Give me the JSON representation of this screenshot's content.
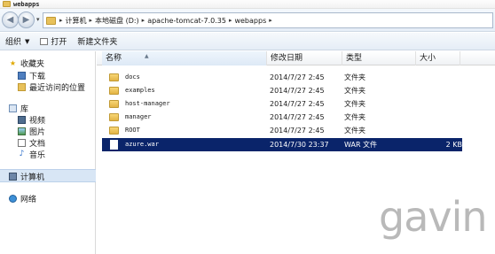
{
  "window": {
    "title": "webapps"
  },
  "address": {
    "crumbs": [
      "计算机",
      "本地磁盘 (D:)",
      "apache-tomcat-7.0.35",
      "webapps"
    ]
  },
  "toolbar": {
    "organize_label": "组织",
    "open_label": "打开",
    "new_folder_label": "新建文件夹"
  },
  "nav": {
    "favorites_label": "收藏夹",
    "favorites": [
      "下载",
      "最近访问的位置"
    ],
    "libraries_label": "库",
    "libraries": [
      "视频",
      "图片",
      "文档",
      "音乐"
    ],
    "computer_label": "计算机",
    "network_label": "网络"
  },
  "columns": {
    "name": "名称",
    "date": "修改日期",
    "type": "类型",
    "size": "大小"
  },
  "files": [
    {
      "name": "docs",
      "date": "2014/7/27 2:45",
      "type": "文件夹",
      "size": ""
    },
    {
      "name": "examples",
      "date": "2014/7/27 2:45",
      "type": "文件夹",
      "size": ""
    },
    {
      "name": "host-manager",
      "date": "2014/7/27 2:45",
      "type": "文件夹",
      "size": ""
    },
    {
      "name": "manager",
      "date": "2014/7/27 2:45",
      "type": "文件夹",
      "size": ""
    },
    {
      "name": "ROOT",
      "date": "2014/7/27 2:45",
      "type": "文件夹",
      "size": ""
    },
    {
      "name": "azure.war",
      "date": "2014/7/30 23:37",
      "type": "WAR 文件",
      "size": "2 KB"
    }
  ],
  "watermark": "gavin",
  "colors": {
    "selection": "#0a246a",
    "folder": "#e8c15a",
    "chrome": "#e6eef7"
  }
}
